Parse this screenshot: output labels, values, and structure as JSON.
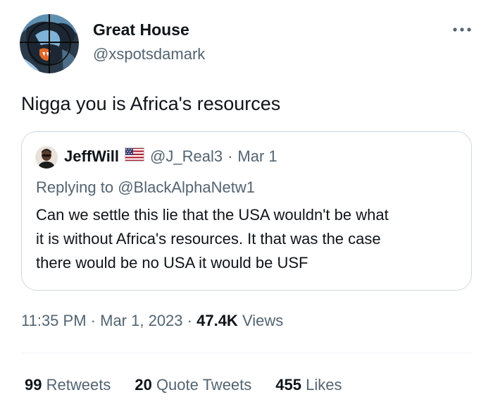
{
  "author": {
    "display_name": "Great House",
    "handle": "@xspotsdamark",
    "avatar_icon": "gorilla-avatar-icon"
  },
  "tweet": {
    "text": "Nigga you is Africa's resources"
  },
  "quoted_tweet": {
    "display_name": "JeffWill",
    "flag_icon": "us-flag-icon",
    "handle": "@J_Real3",
    "separator": "·",
    "date": "Mar 1",
    "replying_to_prefix": "Replying to",
    "replying_to_handle": "@BlackAlphaNetw1",
    "body_lines": [
      "Can we settle this lie that the USA wouldn't be what",
      "it is without Africa's resources. It that was the case",
      "there would be no USA it would be USF"
    ]
  },
  "meta": {
    "time": "11:35 PM",
    "separator": "·",
    "date": "Mar 1, 2023",
    "views_count": "47.4K",
    "views_label": "Views"
  },
  "stats": {
    "retweets_count": "99",
    "retweets_label": "Retweets",
    "quotes_count": "20",
    "quotes_label": "Quote Tweets",
    "likes_count": "455",
    "likes_label": "Likes"
  },
  "colors": {
    "primary_text": "#0f1419",
    "secondary_text": "#536471",
    "border": "#cfd9de"
  }
}
